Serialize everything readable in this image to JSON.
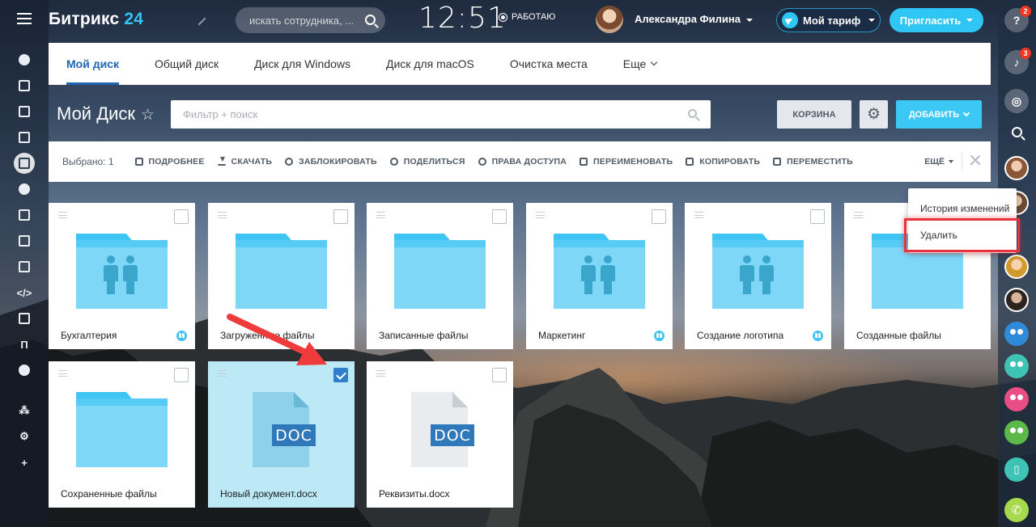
{
  "header": {
    "logo_text": "Битрикс",
    "logo_num": "24",
    "search_placeholder": "искать сотрудника, ...",
    "clock": "12:51",
    "status": "РАБОТАЮ",
    "user_name": "Александра Филина",
    "tariff_label": "Мой тариф",
    "invite_label": "Пригласить"
  },
  "tabs": [
    {
      "label": "Мой диск",
      "active": true
    },
    {
      "label": "Общий диск"
    },
    {
      "label": "Диск для Windows"
    },
    {
      "label": "Диск для macOS"
    },
    {
      "label": "Очистка места"
    },
    {
      "label": "Еще"
    }
  ],
  "title_row": {
    "title": "Мой Диск",
    "filter_placeholder": "Фильтр + поиск",
    "trash_label": "КОРЗИНА",
    "add_label": "ДОБАВИТЬ"
  },
  "toolbar": {
    "selected": "Выбрано: 1",
    "details": "ПОДРОБНЕЕ",
    "download": "СКАЧАТЬ",
    "lock": "ЗАБЛОКИРОВАТЬ",
    "share": "ПОДЕЛИТЬСЯ",
    "rights": "ПРАВА ДОСТУПА",
    "rename": "ПЕРЕИМЕНОВАТЬ",
    "copy": "КОПИРОВАТЬ",
    "move": "ПЕРЕМЕСТИТЬ",
    "more": "ЕЩЁ"
  },
  "menu": {
    "history": "История изменений",
    "delete": "Удалить"
  },
  "files": [
    {
      "name": "Бухгалтерия",
      "type": "folder",
      "shared": true
    },
    {
      "name": "Загруженные файлы",
      "type": "folder",
      "shared": false
    },
    {
      "name": "Записанные файлы",
      "type": "folder",
      "shared": false
    },
    {
      "name": "Маркетинг",
      "type": "folder",
      "shared": true
    },
    {
      "name": "Создание логотипа",
      "type": "folder",
      "shared": true
    },
    {
      "name": "Созданные файлы",
      "type": "folder",
      "shared": false
    },
    {
      "name": "Сохраненные файлы",
      "type": "folder",
      "shared": false
    },
    {
      "name": "Новый документ.docx",
      "type": "doc",
      "selected": true
    },
    {
      "name": "Реквизиты.docx",
      "type": "doc"
    }
  ],
  "doc_label": "DOC",
  "left_nav_letter": "П",
  "right_bar": {
    "help_glyph": "?",
    "help_badge": "2",
    "notif_badge": "3"
  },
  "colors": {
    "accent": "#2fc6f6",
    "active_tab": "#2067b0",
    "highlight": "#e8343f"
  }
}
